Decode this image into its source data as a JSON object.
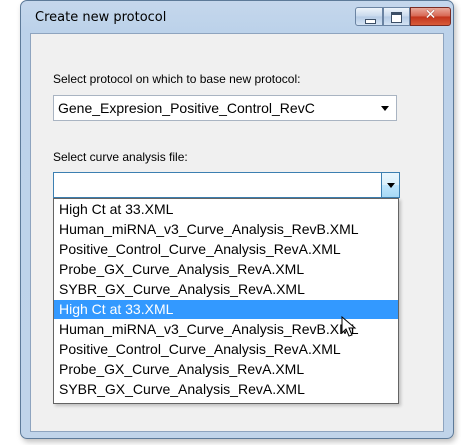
{
  "window": {
    "title": "Create new protocol",
    "close_glyph": "✕"
  },
  "protocol_section": {
    "label": "Select protocol on which to base new protocol:",
    "selected_value": "Gene_Expresion_Positive_Control_RevC"
  },
  "curve_section": {
    "label": "Select curve analysis file:",
    "selected_value": ""
  },
  "dropdown": {
    "items": [
      "High Ct at 33.XML",
      "Human_miRNA_v3_Curve_Analysis_RevB.XML",
      "Positive_Control_Curve_Analysis_RevA.XML",
      "Probe_GX_Curve_Analysis_RevA.XML",
      "SYBR_GX_Curve_Analysis_RevA.XML",
      "High Ct at 33.XML",
      "Human_miRNA_v3_Curve_Analysis_RevB.XML",
      "Positive_Control_Curve_Analysis_RevA.XML",
      "Probe_GX_Curve_Analysis_RevA.XML",
      "SYBR_GX_Curve_Analysis_RevA.XML"
    ],
    "highlighted_index": 5
  },
  "icons": {
    "minimize": "minimize-icon",
    "maximize": "maximize-icon",
    "close": "close-icon",
    "dropdown_arrow": "chevron-down-icon",
    "cursor": "mouse-pointer-icon"
  },
  "colors": {
    "selection": "#3399ff",
    "close_button": "#c2331b",
    "window_frame": "#bcd2ea"
  }
}
